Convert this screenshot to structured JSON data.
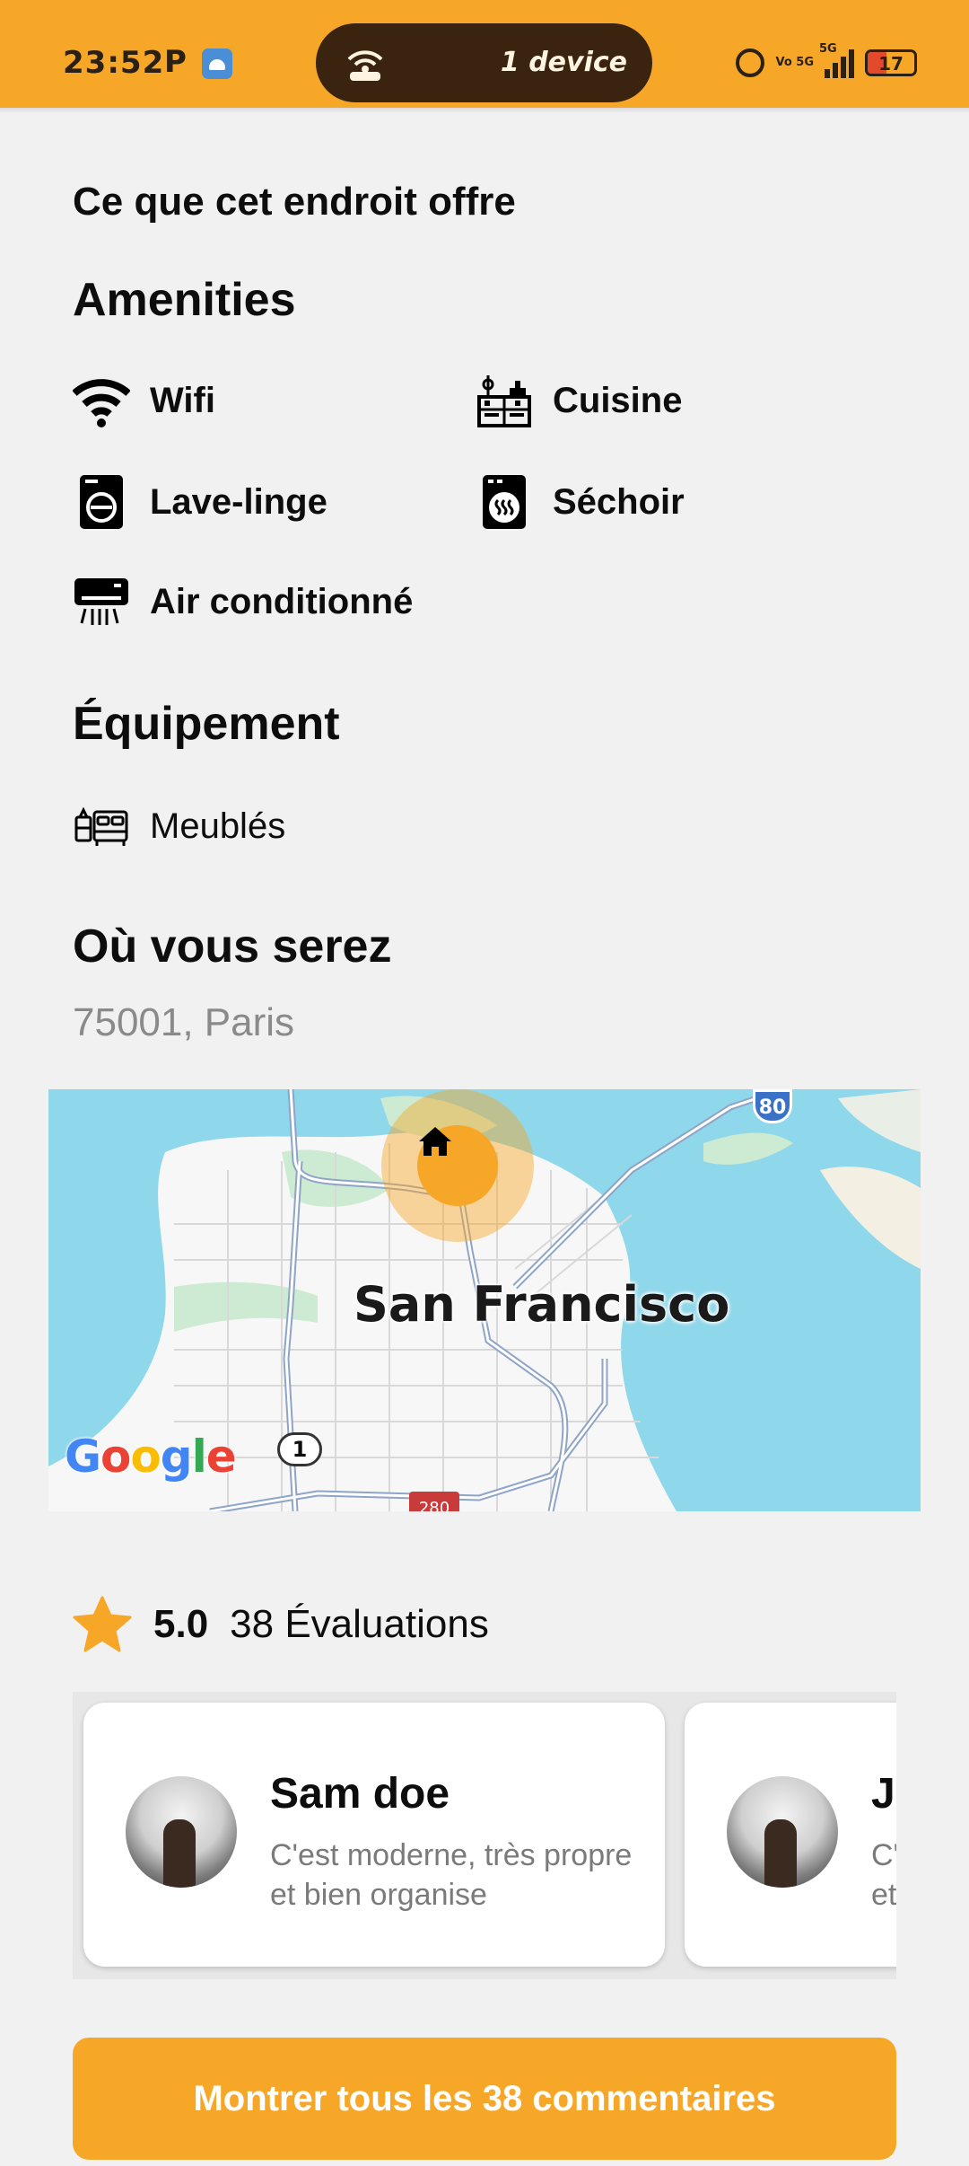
{
  "status_bar": {
    "time": "23:52",
    "notification_letter": "P",
    "hotspot_label": "1 device",
    "volte_text": "Vo 5G",
    "network_text": "5G",
    "battery_level": "17",
    "accent_color": "#f7a728"
  },
  "offer": {
    "title": "Ce que cet endroit offre",
    "amenities_title": "Amenities",
    "amenities": [
      {
        "label": "Wifi",
        "icon": "wifi-icon"
      },
      {
        "label": "Cuisine",
        "icon": "kitchen-icon"
      },
      {
        "label": "Lave-linge",
        "icon": "washer-icon"
      },
      {
        "label": "Séchoir",
        "icon": "dryer-icon"
      },
      {
        "label": "Air conditionné",
        "icon": "air-conditioner-icon"
      }
    ],
    "equipment_title": "Équipement",
    "equipment": [
      {
        "label": "Meublés",
        "icon": "furniture-icon"
      }
    ]
  },
  "location": {
    "title": "Où vous serez",
    "address": "75001, Paris",
    "map": {
      "city_label": "San Francisco",
      "attribution": [
        "G",
        "o",
        "o",
        "g",
        "l",
        "e"
      ],
      "route_1": "1",
      "route_80": "80",
      "route_280": "280",
      "marker_icon": "home-icon"
    }
  },
  "reviews": {
    "rating": "5.0",
    "count_label": "38 Évaluations",
    "items": [
      {
        "name": "Sam doe",
        "comment": "C'est moderne, très propre et bien organise"
      },
      {
        "name": "Jane doe",
        "comment": "C'est moderne, très propre et bien organise"
      }
    ],
    "show_all_label": "Montrer tous les 38 commentaires"
  }
}
